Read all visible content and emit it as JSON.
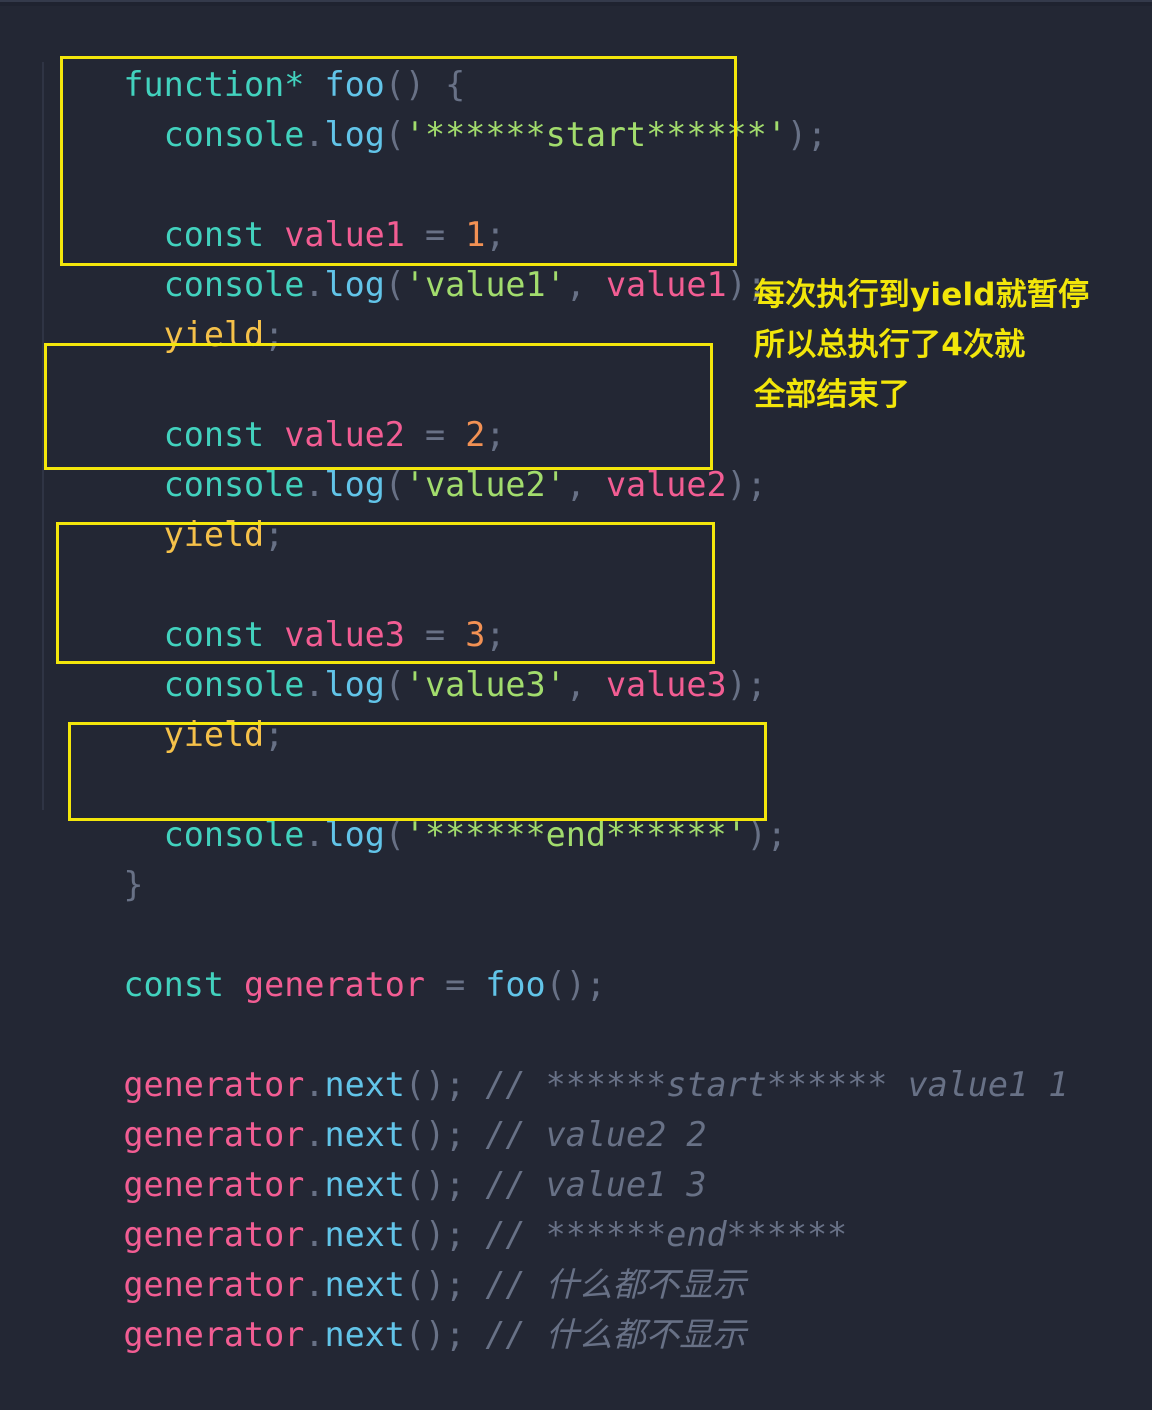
{
  "editor": {
    "theme_colors": {
      "background": "#232734",
      "keyword": "#42d2be",
      "identifier": "#f25d93",
      "function": "#62c4e8",
      "string": "#a2dc6d",
      "number": "#f29154",
      "yield": "#f5c14a",
      "punctuation": "#687186",
      "comment": "#687186",
      "annotation": "#f2e60a"
    },
    "code": {
      "fn_keyword": "function",
      "fn_star": "*",
      "fn_name": "foo",
      "parens": "()",
      "open_brace": "{",
      "close_brace": "}",
      "console_obj": "console",
      "log_method": "log",
      "dot": ".",
      "open_paren": "(",
      "close_paren": ")",
      "paren_semicolon": ");",
      "comma": ", ",
      "semicolon": ";",
      "equals": " = ",
      "const_kw": "const",
      "yield_kw": "yield",
      "start_str": "'******start******'",
      "end_str": "'******end******'",
      "value1_name": "value1",
      "value2_name": "value2",
      "value3_name": "value3",
      "value1_num": "1",
      "value2_num": "2",
      "value3_num": "3",
      "value1_str": "'value1'",
      "value2_str": "'value2'",
      "value3_str": "'value3'",
      "generator_name": "generator",
      "next_method": "next",
      "call_parens": "();",
      "comments": [
        "// ******start****** value1 1",
        "// value2 2",
        "// value1 3",
        "// ******end******",
        "// 什么都不显示",
        "// 什么都不显示"
      ]
    },
    "annotation": {
      "lines": [
        "每次执行到yield就暂停",
        "所以总执行了4次就",
        "全部结束了"
      ]
    }
  }
}
